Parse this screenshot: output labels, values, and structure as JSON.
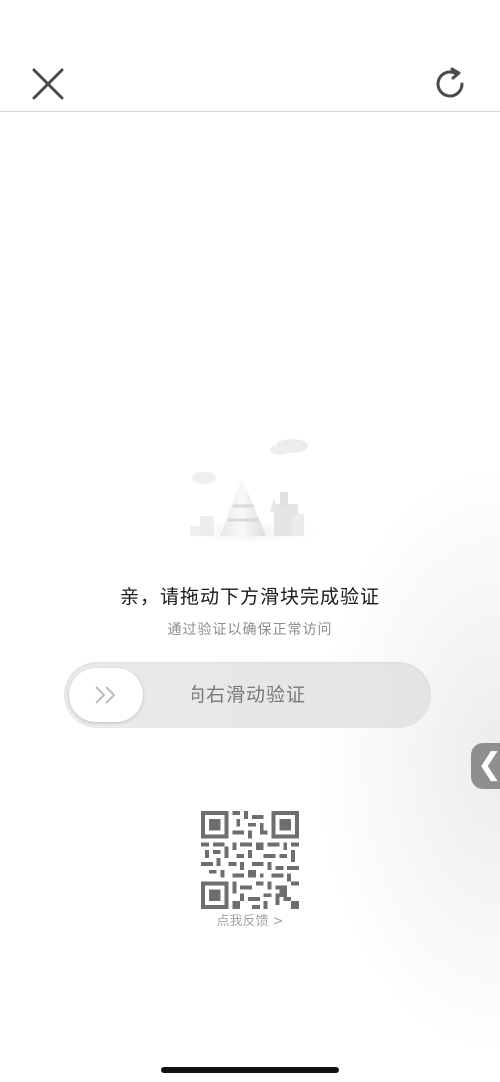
{
  "verification": {
    "title": "亲，请拖动下方滑块完成验证",
    "subtitle": "通过验证以确保正常访问",
    "slider_text": "向右滑动验证"
  },
  "feedback": {
    "label": "点我反馈 >"
  },
  "side_handle": {
    "glyph": "❮"
  },
  "icons": {
    "close": "close-icon",
    "refresh": "refresh-icon",
    "slider_arrow": "double-chevron-right-icon",
    "qr": "qr-code-image"
  },
  "colors": {
    "title_text": "#1a1a1a",
    "subtitle_text": "#8d8d8d",
    "track": "#e6e6e6",
    "side_handle": "#8f8f8f"
  }
}
